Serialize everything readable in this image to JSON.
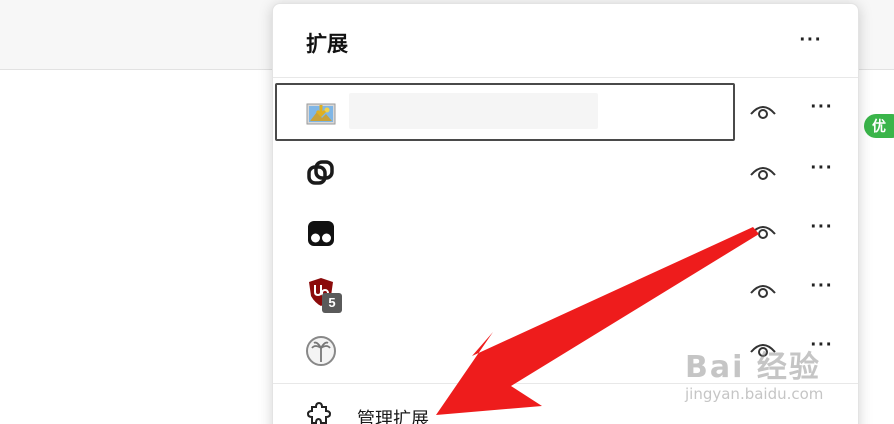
{
  "panel": {
    "title": "扩展",
    "more_label": "···"
  },
  "extensions": [
    {
      "icon": "image-downloader-icon",
      "selected": true
    },
    {
      "icon": "linked-rings-icon"
    },
    {
      "icon": "tampermonkey-icon"
    },
    {
      "icon": "ublock-origin-icon",
      "badge": "5"
    },
    {
      "icon": "palm-tree-icon"
    }
  ],
  "row_action": {
    "visibility_icon": "eye-icon",
    "more_label": "···"
  },
  "footer": {
    "manage_label": "管理扩展",
    "icon": "puzzle-icon"
  },
  "page_badge": "优",
  "watermark": {
    "brand": "Bai 经验",
    "url": "jingyan.baidu.com"
  },
  "colors": {
    "arrow": "#ee1c1c",
    "badge_green": "#3ab54a",
    "selection_border": "#4a4a4a"
  }
}
